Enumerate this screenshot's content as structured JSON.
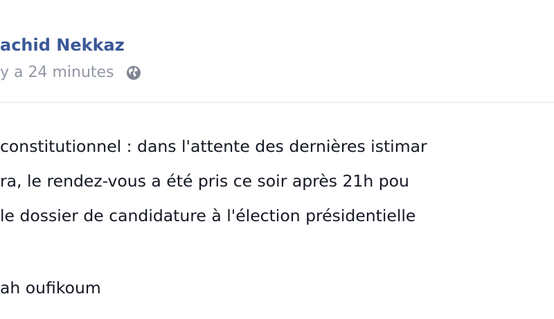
{
  "post": {
    "author_name": "achid Nekkaz",
    "timestamp": "y a 24 minutes",
    "privacy_icon": "globe-icon",
    "lines": [
      "constitutionnel : dans l'attente des dernières istimar",
      "ra, le rendez-vous a été pris ce soir après 21h pou",
      "le dossier de candidature à l'élection présidentielle",
      "ah oufikoum"
    ]
  },
  "colors": {
    "author_link": "#3b5998",
    "timestamp": "#9197a3",
    "body_text": "#141823",
    "divider": "#e1e2e5",
    "globe_icon": "#7f8591"
  }
}
